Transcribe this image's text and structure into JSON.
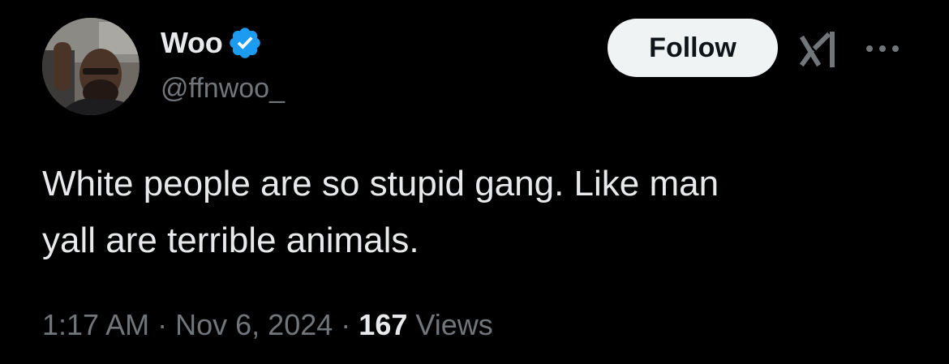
{
  "author": {
    "display_name": "Woo",
    "handle": "@ffnwoo_",
    "verified": true,
    "avatar_icon": "profile-photo"
  },
  "actions": {
    "follow_label": "Follow",
    "grok_icon": "grok-icon",
    "more_icon": "more-horizontal-icon"
  },
  "tweet": {
    "text": "White people are so stupid gang. Like man\nyall are terrible animals."
  },
  "meta": {
    "time": "1:17 AM",
    "separator": "·",
    "date": "Nov 6, 2024",
    "views_count": "167",
    "views_label": "Views"
  },
  "colors": {
    "background": "#000000",
    "primary_text": "#e7e9ea",
    "secondary_text": "#71767b",
    "verified_blue": "#1d9bf0",
    "follow_bg": "#eff3f4"
  }
}
